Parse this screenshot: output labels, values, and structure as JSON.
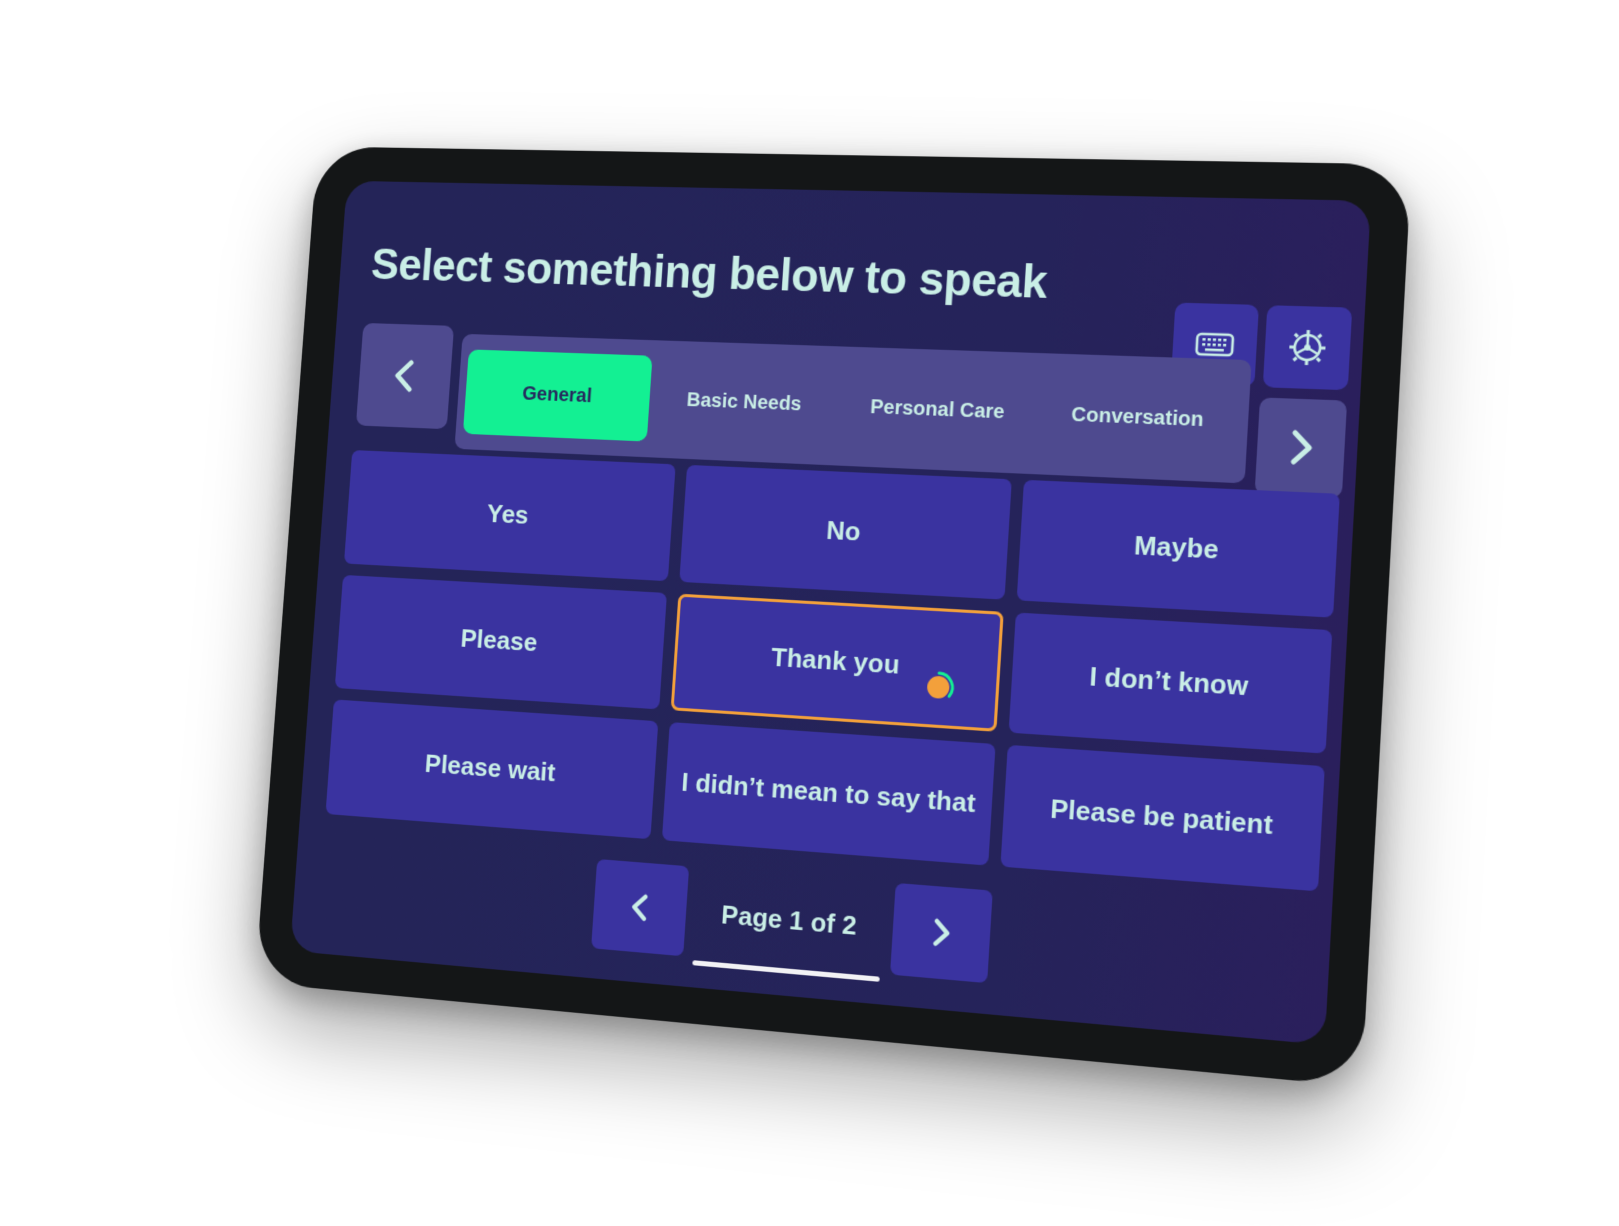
{
  "header": {
    "title": "Select something below to speak",
    "keyboard_icon": "keyboard-icon",
    "settings_icon": "gear-icon"
  },
  "categories": {
    "prev_icon": "chevron-left-icon",
    "next_icon": "chevron-right-icon",
    "tabs": [
      {
        "label": "General",
        "active": true
      },
      {
        "label": "Basic Needs",
        "active": false
      },
      {
        "label": "Personal Care",
        "active": false
      },
      {
        "label": "Conversation",
        "active": false
      }
    ]
  },
  "phrases": [
    {
      "label": "Yes"
    },
    {
      "label": "No"
    },
    {
      "label": "Maybe"
    },
    {
      "label": "Please"
    },
    {
      "label": "Thank you",
      "focused": true,
      "dwell_progress": 0.35
    },
    {
      "label": "I don’t know"
    },
    {
      "label": "Please wait"
    },
    {
      "label": "I didn’t mean to say that"
    },
    {
      "label": "Please be patient"
    }
  ],
  "pagination": {
    "label": "Page 1 of 2",
    "current": 1,
    "total": 2
  },
  "colors": {
    "background": "#242458",
    "tile": "#3a33a0",
    "tab_bar": "#4e4a8f",
    "active_tab": "#13f093",
    "focus_border": "#f3a03b",
    "dwell_dot": "#f3a03b",
    "dwell_ring": "#13f093",
    "text": "#c9eee6"
  }
}
